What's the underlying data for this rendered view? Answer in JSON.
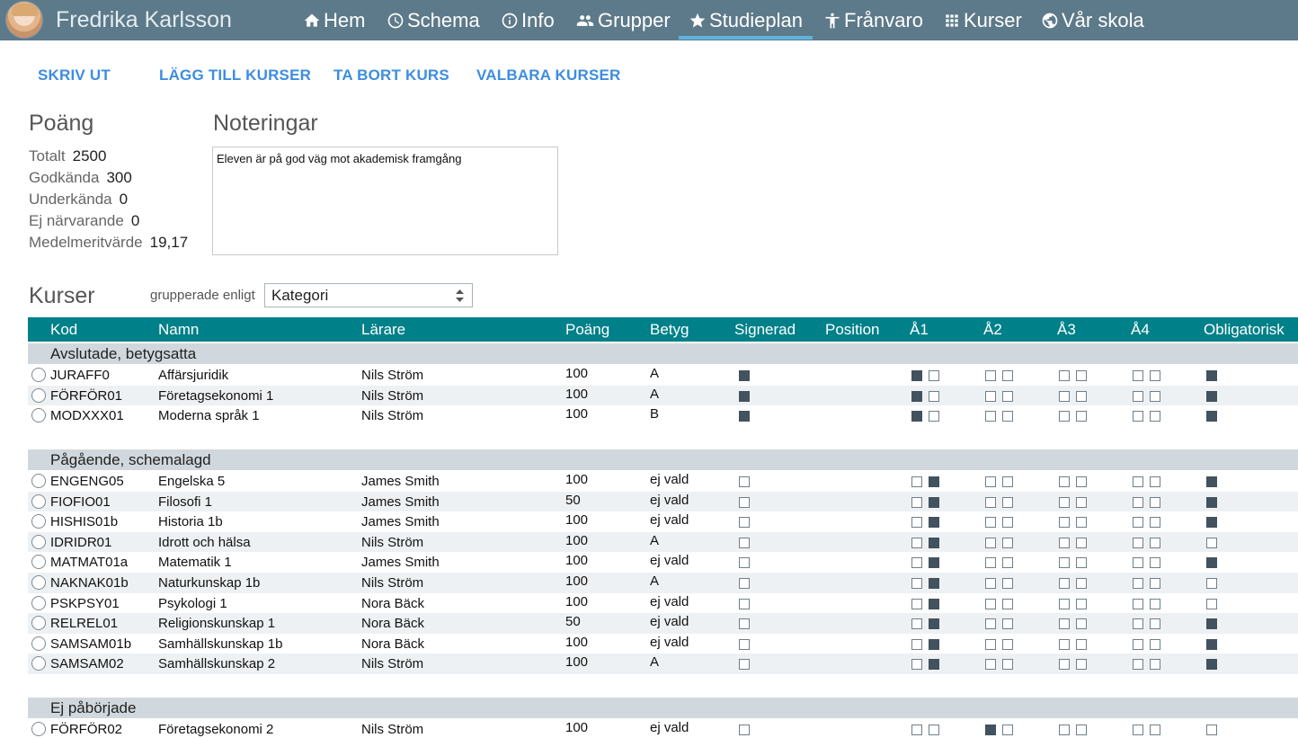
{
  "header": {
    "user_name": "Fredrika Karlsson",
    "nav": [
      {
        "label": "Hem",
        "icon": "home-icon"
      },
      {
        "label": "Schema",
        "icon": "clock-icon"
      },
      {
        "label": "Info",
        "icon": "info-icon"
      },
      {
        "label": "Grupper",
        "icon": "group-icon"
      },
      {
        "label": "Studieplan",
        "icon": "star-icon",
        "active": true
      },
      {
        "label": "Frånvaro",
        "icon": "person-icon"
      },
      {
        "label": "Kurser",
        "icon": "grid-icon"
      },
      {
        "label": "Vår skola",
        "icon": "globe-icon"
      }
    ]
  },
  "actions": {
    "print": "SKRIV UT",
    "add_courses": "LÄGG TILL KURSER",
    "remove_course": "TA BORT KURS",
    "elective_courses": "VALBARA KURSER"
  },
  "points": {
    "heading": "Poäng",
    "stats": [
      {
        "label": "Totalt",
        "value": "2500"
      },
      {
        "label": "Godkända",
        "value": "300"
      },
      {
        "label": "Underkända",
        "value": "0"
      },
      {
        "label": "Ej närvarande",
        "value": "0"
      },
      {
        "label": "Medelmeritvärde",
        "value": "19,17"
      }
    ]
  },
  "notes": {
    "heading": "Noteringar",
    "text": "Eleven är på god väg mot akademisk framgång"
  },
  "courses": {
    "heading": "Kurser",
    "group_by_label": "grupperade enligt",
    "group_by_value": "Kategori",
    "columns": [
      "Kod",
      "Namn",
      "Lärare",
      "Poäng",
      "Betyg",
      "Signerad",
      "Position",
      "Å1",
      "Å2",
      "Å3",
      "Å4",
      "Obligatorisk"
    ],
    "groups": [
      {
        "title": "Avslutade, betygsatta",
        "rows": [
          {
            "code": "JURAFF0",
            "name": "Affärsjuridik",
            "teacher": "Nils Ström",
            "points": "100",
            "grade": "A",
            "signed": true,
            "years": [
              [
                true,
                false
              ],
              [
                false,
                false
              ],
              [
                false,
                false
              ],
              [
                false,
                false
              ]
            ],
            "mandatory": true
          },
          {
            "code": "FÖRFÖR01",
            "name": "Företagsekonomi 1",
            "teacher": "Nils Ström",
            "points": "100",
            "grade": "A",
            "signed": true,
            "years": [
              [
                true,
                false
              ],
              [
                false,
                false
              ],
              [
                false,
                false
              ],
              [
                false,
                false
              ]
            ],
            "mandatory": true
          },
          {
            "code": "MODXXX01",
            "name": "Moderna språk 1",
            "teacher": "Nils Ström",
            "points": "100",
            "grade": "B",
            "signed": true,
            "years": [
              [
                true,
                false
              ],
              [
                false,
                false
              ],
              [
                false,
                false
              ],
              [
                false,
                false
              ]
            ],
            "mandatory": true
          }
        ]
      },
      {
        "title": "Pågående, schemalagd",
        "rows": [
          {
            "code": "ENGENG05",
            "name": "Engelska 5",
            "teacher": "James Smith",
            "points": "100",
            "grade": "ej vald",
            "signed": false,
            "years": [
              [
                false,
                true
              ],
              [
                false,
                false
              ],
              [
                false,
                false
              ],
              [
                false,
                false
              ]
            ],
            "mandatory": true
          },
          {
            "code": "FIOFIO01",
            "name": "Filosofi 1",
            "teacher": "James Smith",
            "points": "50",
            "grade": "ej vald",
            "signed": false,
            "years": [
              [
                false,
                true
              ],
              [
                false,
                false
              ],
              [
                false,
                false
              ],
              [
                false,
                false
              ]
            ],
            "mandatory": true
          },
          {
            "code": "HISHIS01b",
            "name": "Historia 1b",
            "teacher": "James Smith",
            "points": "100",
            "grade": "ej vald",
            "signed": false,
            "years": [
              [
                false,
                true
              ],
              [
                false,
                false
              ],
              [
                false,
                false
              ],
              [
                false,
                false
              ]
            ],
            "mandatory": true
          },
          {
            "code": "IDRIDR01",
            "name": "Idrott och hälsa",
            "teacher": "Nils Ström",
            "points": "100",
            "grade": "A",
            "signed": false,
            "years": [
              [
                false,
                true
              ],
              [
                false,
                false
              ],
              [
                false,
                false
              ],
              [
                false,
                false
              ]
            ],
            "mandatory": false
          },
          {
            "code": "MATMAT01a",
            "name": "Matematik 1",
            "teacher": "James Smith",
            "points": "100",
            "grade": "ej vald",
            "signed": false,
            "years": [
              [
                false,
                true
              ],
              [
                false,
                false
              ],
              [
                false,
                false
              ],
              [
                false,
                false
              ]
            ],
            "mandatory": true
          },
          {
            "code": "NAKNAK01b",
            "name": "Naturkunskap 1b",
            "teacher": "Nils Ström",
            "points": "100",
            "grade": "A",
            "signed": false,
            "years": [
              [
                false,
                true
              ],
              [
                false,
                false
              ],
              [
                false,
                false
              ],
              [
                false,
                false
              ]
            ],
            "mandatory": false
          },
          {
            "code": "PSKPSY01",
            "name": "Psykologi 1",
            "teacher": "Nora Bäck",
            "points": "100",
            "grade": "ej vald",
            "signed": false,
            "years": [
              [
                false,
                true
              ],
              [
                false,
                false
              ],
              [
                false,
                false
              ],
              [
                false,
                false
              ]
            ],
            "mandatory": false
          },
          {
            "code": "RELREL01",
            "name": "Religionskunskap 1",
            "teacher": "Nora Bäck",
            "points": "50",
            "grade": "ej vald",
            "signed": false,
            "years": [
              [
                false,
                true
              ],
              [
                false,
                false
              ],
              [
                false,
                false
              ],
              [
                false,
                false
              ]
            ],
            "mandatory": true
          },
          {
            "code": "SAMSAM01b",
            "name": "Samhällskunskap 1b",
            "teacher": "Nora Bäck",
            "points": "100",
            "grade": "ej vald",
            "signed": false,
            "years": [
              [
                false,
                true
              ],
              [
                false,
                false
              ],
              [
                false,
                false
              ],
              [
                false,
                false
              ]
            ],
            "mandatory": true
          },
          {
            "code": "SAMSAM02",
            "name": "Samhällskunskap 2",
            "teacher": "Nils Ström",
            "points": "100",
            "grade": "A",
            "signed": false,
            "years": [
              [
                false,
                true
              ],
              [
                false,
                false
              ],
              [
                false,
                false
              ],
              [
                false,
                false
              ]
            ],
            "mandatory": true
          }
        ]
      },
      {
        "title": "Ej påbörjade",
        "rows": [
          {
            "code": "FÖRFÖR02",
            "name": "Företagsekonomi 2",
            "teacher": "Nils Ström",
            "points": "100",
            "grade": "ej vald",
            "signed": false,
            "years": [
              [
                false,
                false
              ],
              [
                true,
                false
              ],
              [
                false,
                false
              ],
              [
                false,
                false
              ]
            ],
            "mandatory": false
          }
        ]
      }
    ]
  }
}
